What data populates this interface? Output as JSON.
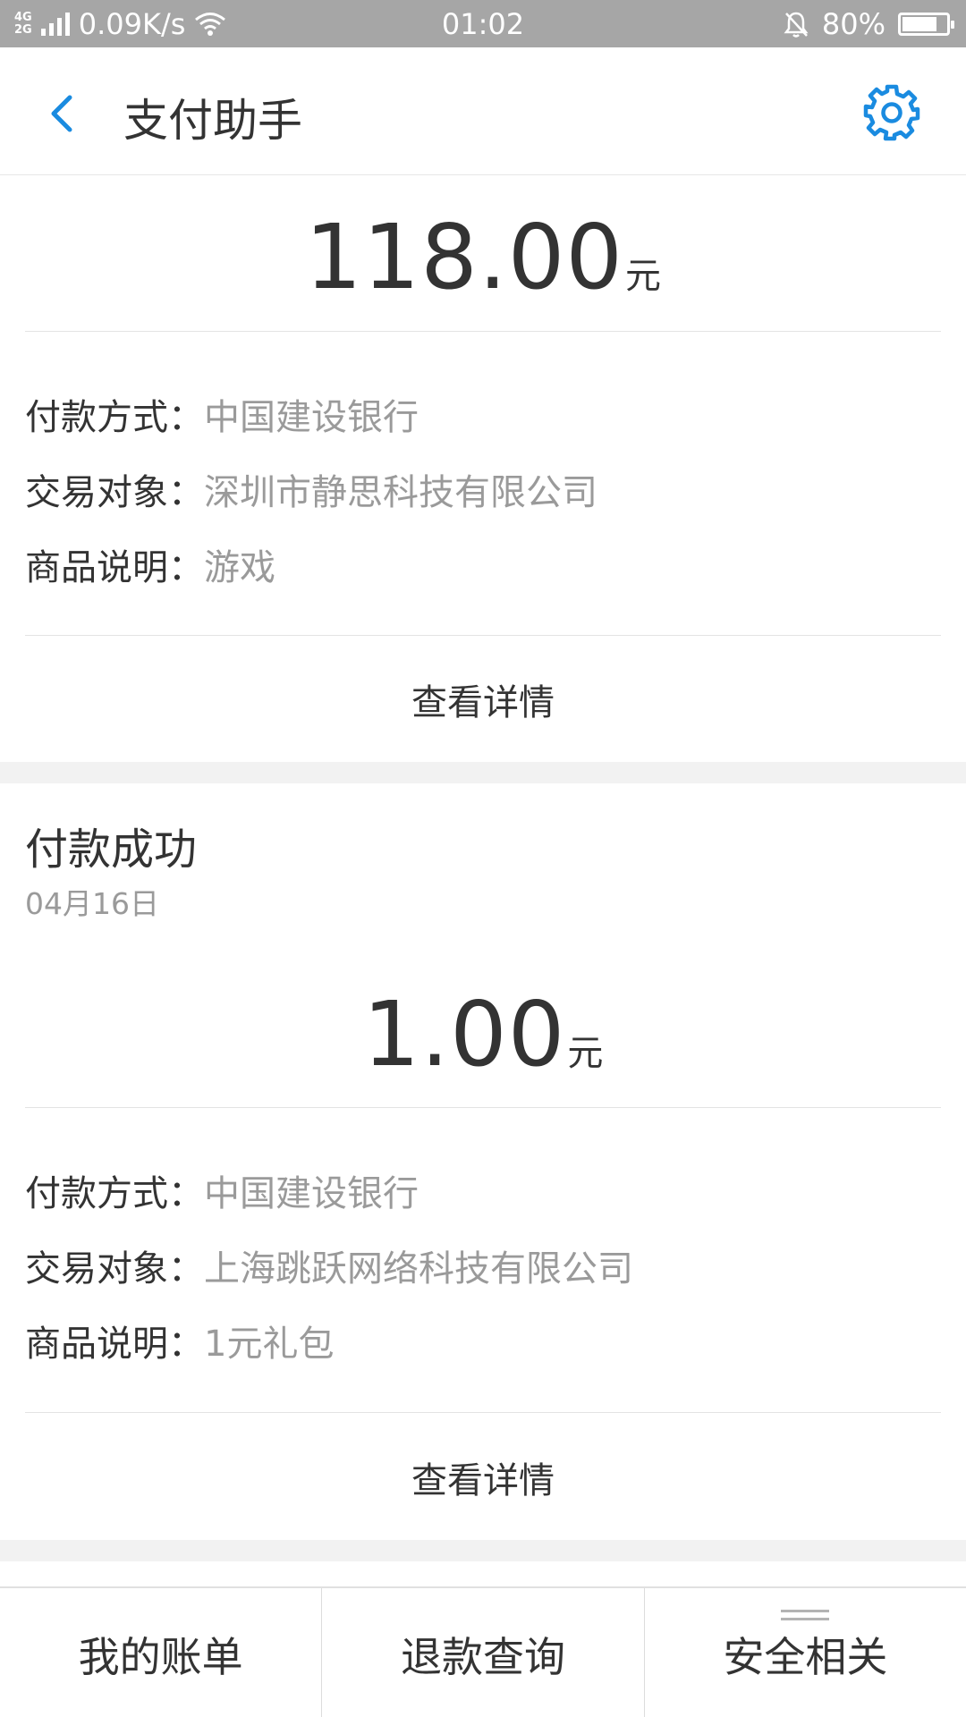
{
  "status_bar": {
    "network_top": "4G",
    "network_bottom": "2G",
    "speed": "0.09K/s",
    "time": "01:02",
    "battery": "80%",
    "battery_level": 0.8,
    "icons": [
      "signal-icon",
      "wifi-icon",
      "mute-bell-icon",
      "battery-icon"
    ]
  },
  "header": {
    "title": "支付助手",
    "back_icon": "chevron-left-icon",
    "settings_icon": "gear-icon",
    "accent_color": "#1a8be0"
  },
  "transactions": [
    {
      "amount": "118.00",
      "unit": "元",
      "rows": [
        {
          "label": "付款方式：",
          "value": "中国建设银行"
        },
        {
          "label": "交易对象：",
          "value": "深圳市静思科技有限公司"
        },
        {
          "label": "商品说明：",
          "value": "游戏"
        }
      ],
      "detail_label": "查看详情"
    },
    {
      "status": "付款成功",
      "date": "04月16日",
      "amount": "1.00",
      "unit": "元",
      "rows": [
        {
          "label": "付款方式：",
          "value": "中国建设银行"
        },
        {
          "label": "交易对象：",
          "value": "上海跳跃网络科技有限公司"
        },
        {
          "label": "商品说明：",
          "value": "1元礼包"
        }
      ],
      "detail_label": "查看详情"
    }
  ],
  "bottom_tabs": [
    {
      "label": "我的账单"
    },
    {
      "label": "退款查询"
    },
    {
      "label": "安全相关",
      "icon": "menu-lines-icon"
    }
  ]
}
